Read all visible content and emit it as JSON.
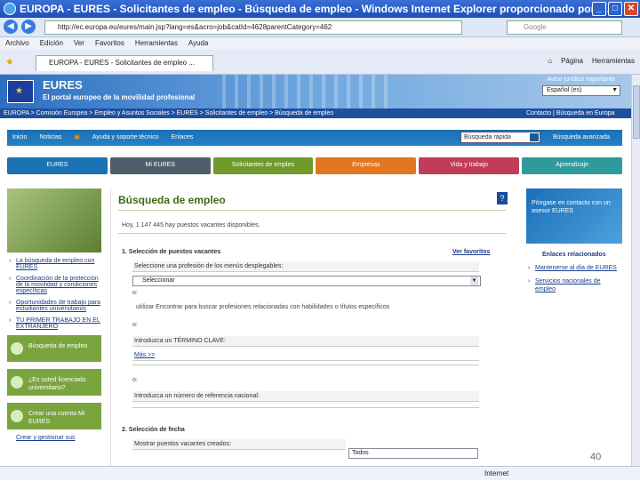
{
  "window": {
    "title": "EUROPA - EURES - Solicitantes de empleo - Búsqueda de empleo - Windows Internet Explorer proporcionado por I...",
    "minimize": "_",
    "maximize": "□",
    "close": "✕"
  },
  "address": {
    "url": "http://ec.europa.eu/eures/main.jsp?lang=es&acro=job&catId=4628parentCategory=462",
    "search_placeholder": "Google"
  },
  "menu": [
    "Archivo",
    "Edición",
    "Ver",
    "Favoritos",
    "Herramientas",
    "Ayuda"
  ],
  "tab": {
    "label": "EUROPA - EURES - Solicitantes de empleo ..."
  },
  "favtools": {
    "page": "Página",
    "tools": "Herramientas"
  },
  "status": {
    "text": "",
    "zone": "Internet"
  },
  "header": {
    "title": "EURES",
    "subtitle": "El portal europeo de la movilidad profesional",
    "legal": "Aviso jurídico importante",
    "language": "Español (es)"
  },
  "breadcrumb": {
    "path": "EUROPA > Comisión Europea > Empleo y Asuntos Sociales > EURES > Solicitantes de empleo > Búsqueda de empleo",
    "right": "Contacto | Búsqueda en Europa"
  },
  "topnav": [
    "Inicio",
    "Noticias",
    "Ayuda y soporte técnico",
    "Enlaces"
  ],
  "quicksearch": {
    "placeholder": "Búsqueda rápida",
    "advanced": "Búsqueda avanzada"
  },
  "secnav": [
    {
      "label": "EURES",
      "color": "#1a71b3"
    },
    {
      "label": "Mi EURES",
      "color": "#4f5e6d"
    },
    {
      "label": "Solicitantes de empleo",
      "color": "#6e9a2b"
    },
    {
      "label": "Empresas",
      "color": "#e3761f"
    },
    {
      "label": "Vida y trabajo",
      "color": "#c23b59"
    },
    {
      "label": "Aprendizaje",
      "color": "#2f9a9a"
    }
  ],
  "left": {
    "links": [
      "La búsqueda de empleo con EURES",
      "Coordinación de la protección de la movilidad y condiciones específicas",
      "Oportunidades de trabajo para estudiantes universitarios",
      "TU PRIMER TRABAJO EN EL EXTRANJERO"
    ],
    "boxes": [
      "Búsqueda de empleo",
      "¿Es usted licenciado universitario?",
      "Crear una cuenta Mi EURES"
    ],
    "footer_link": "Crear y gestionar sus"
  },
  "main": {
    "title": "Búsqueda de empleo",
    "count": "Hoy, 1 147 445 hay puestos vacantes disponibles.",
    "s1": "1. Selección de puestos vacantes",
    "favorites": "Ver favoritos",
    "profession_label": "Seleccione una profesión de los menús desplegables:",
    "profession_select": "Seleccionar",
    "o1": "o:",
    "search_related": "utilizar Encontrar para buscar profesiones relacionadas con habilidades o títulos específicos",
    "o2": "o:",
    "keyword": "Introduzca un TÉRMINO CLAVE:",
    "more": "Más >>",
    "o3": "o:",
    "ref": "Introduzca un número de referencia nacional:",
    "s2": "2. Selección de fecha",
    "date_label": "Mostrar puestos vacantes creados:",
    "date_value": "Todos"
  },
  "right": {
    "box": "Póngase en contacto con un asesor EURES",
    "enlaces": "Enlaces relacionados",
    "links": [
      "Mantenerse al día de EURES",
      "Servicios nacionales de empleo"
    ]
  },
  "pagenum": "40"
}
